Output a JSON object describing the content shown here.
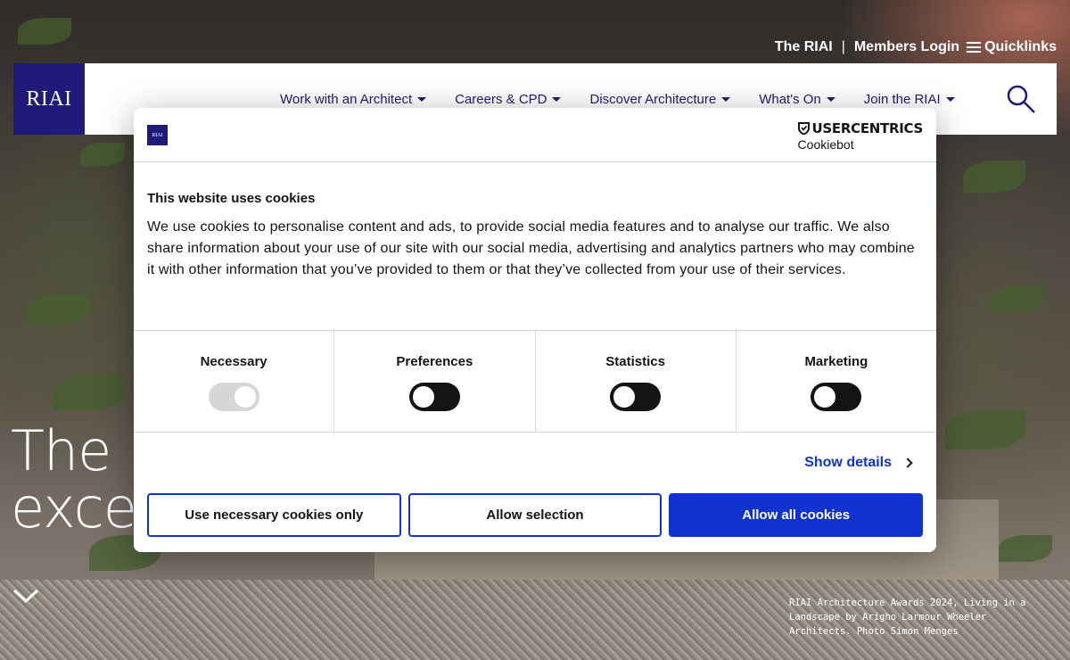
{
  "colors": {
    "brand_navy": "#1f1b7a",
    "accent_blue": "#1032cf",
    "text_dark": "#141414",
    "toggle_off": "#141414",
    "toggle_disabled": "#d6d6d6"
  },
  "top_links": {
    "riai": "The RIAI",
    "separator": "|",
    "members_login": "Members Login",
    "quicklinks": "Quicklinks",
    "quicklinks_icon": "hamburger-icon"
  },
  "header": {
    "logo_text": "RIAI",
    "nav": [
      {
        "label": "Work with an Architect"
      },
      {
        "label": "Careers & CPD"
      },
      {
        "label": "Discover Architecture"
      },
      {
        "label": "What's On"
      },
      {
        "label": "Join the RIAI"
      }
    ],
    "search_icon": "search-icon"
  },
  "hero": {
    "title_line1": "The R",
    "title_line2": "excell",
    "caption": "RIAI Architecture Awards 2024, Living in a Landscape by Arigho Larmour Wheeler Architects. Photo Simon Menges",
    "scroll_icon": "chevron-down-icon"
  },
  "cookie_dialog": {
    "logo_text": "RIAI",
    "brand_top": "USERCENTRICS",
    "brand_bottom": "Cookiebot",
    "title": "This website uses cookies",
    "text": "We use cookies to personalise content and ads, to provide social media features and to analyse our traffic. We also share information about your use of our site with our social media, advertising and analytics partners who may combine it with other information that you’ve provided to them or that they’ve collected from your use of their services.",
    "toggles": [
      {
        "label": "Necessary",
        "state": "on-disabled"
      },
      {
        "label": "Preferences",
        "state": "off"
      },
      {
        "label": "Statistics",
        "state": "off"
      },
      {
        "label": "Marketing",
        "state": "off"
      }
    ],
    "show_details": "Show details",
    "buttons": {
      "necessary_only": "Use necessary cookies only",
      "allow_selection": "Allow selection",
      "allow_all": "Allow all cookies"
    }
  }
}
